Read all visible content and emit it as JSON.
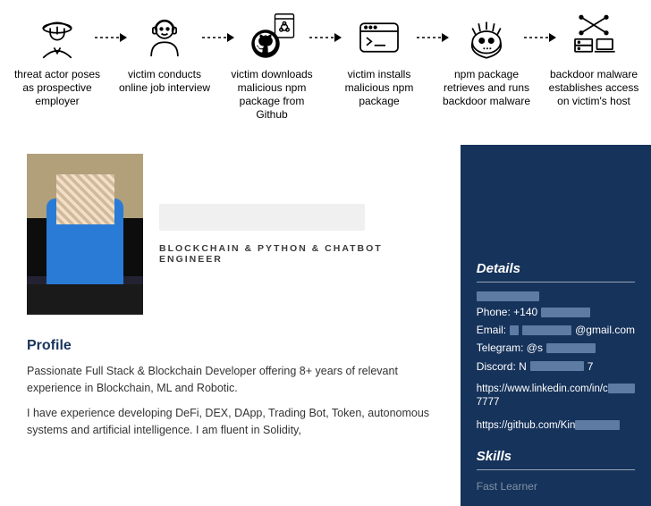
{
  "chain": {
    "steps": [
      {
        "id": "employer",
        "caption": "threat actor poses as prospective employer"
      },
      {
        "id": "interview",
        "caption": "victim conducts online job interview"
      },
      {
        "id": "download",
        "caption": "victim downloads malicious npm package from Github"
      },
      {
        "id": "install",
        "caption": "victim installs malicious npm package"
      },
      {
        "id": "retrieve",
        "caption": "npm package retrieves and runs backdoor malware"
      },
      {
        "id": "backdoor",
        "caption": "backdoor malware establishes access on victim's host"
      }
    ],
    "arrow_style": "dashed"
  },
  "resume": {
    "role_line": "BLOCKCHAIN & PYTHON & CHATBOT ENGINEER",
    "profile_title": "Profile",
    "profile_p1": "Passionate Full Stack & Blockchain Developer offering 8+ years of relevant experience in Blockchain, ML and Robotic.",
    "profile_p2": "I have experience developing DeFi, DEX, DApp, Trading Bot, Token, autonomous systems and artificial intelligence. I am fluent in Solidity,",
    "sidebar": {
      "details_title": "Details",
      "phone_label": "Phone: +140",
      "email_label": "Email:",
      "email_suffix": "@gmail.com",
      "telegram_label": "Telegram: @s",
      "discord_label": "Discord: N",
      "discord_suffix": "7",
      "linkedin_prefix": "https://www.linkedin.com/in/c",
      "linkedin_suffix": "7777",
      "github_prefix": "https://github.com/Kin",
      "skills_title": "Skills",
      "skill_1": "Fast Learner"
    }
  }
}
